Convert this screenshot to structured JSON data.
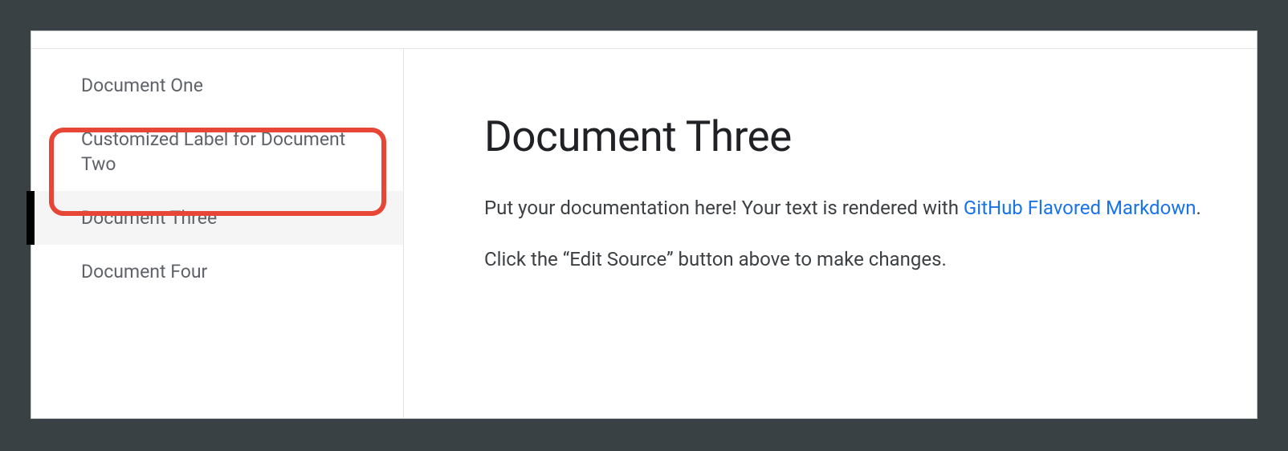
{
  "sidebar": {
    "items": [
      {
        "label": "Document One",
        "active": false,
        "highlighted": false
      },
      {
        "label": "Customized Label for Document Two",
        "active": false,
        "highlighted": true
      },
      {
        "label": "Document Three",
        "active": true,
        "highlighted": false
      },
      {
        "label": "Document Four",
        "active": false,
        "highlighted": false
      }
    ]
  },
  "main": {
    "title": "Document Three",
    "paragraph1_before": "Put your documentation here! Your text is rendered with ",
    "link_text": "GitHub Flavored Markdown",
    "paragraph1_after": ".",
    "paragraph2": "Click the “Edit Source” button above to make changes."
  }
}
